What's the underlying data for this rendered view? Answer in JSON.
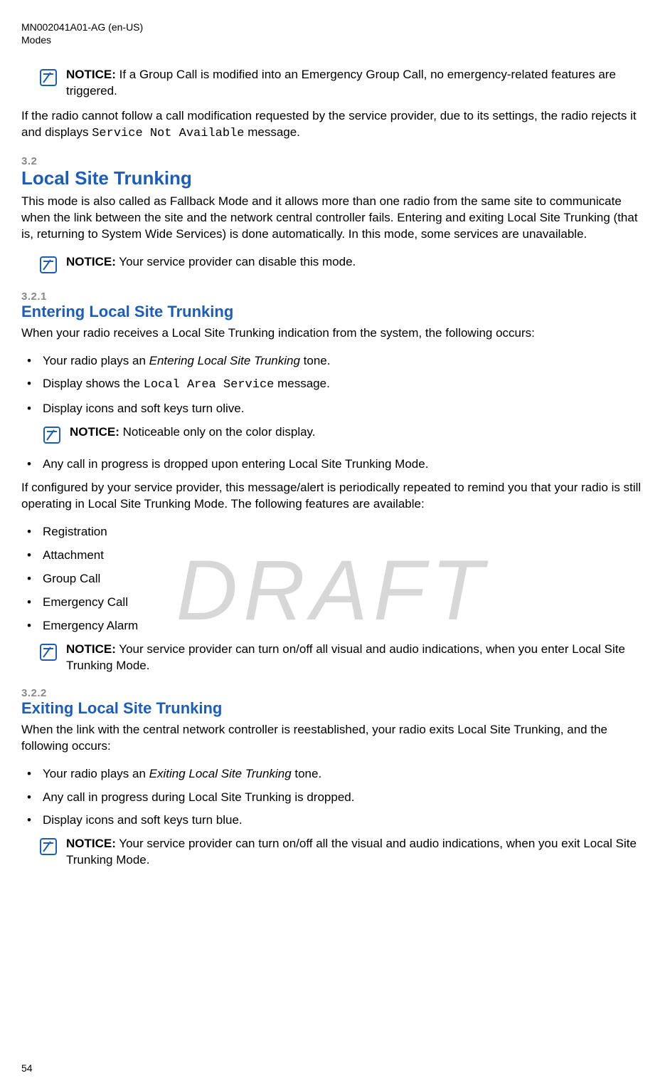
{
  "header": {
    "doc_code": "MN002041A01-AG (en-US)",
    "chapter": "Modes"
  },
  "watermark": "DRAFT",
  "page_number": "54",
  "notices": {
    "n1_label": "NOTICE:",
    "n1_text": " If a Group Call is modified into an Emergency Group Call, no emergency-related features are triggered.",
    "n2_label": "NOTICE:",
    "n2_text": " Your service provider can disable this mode.",
    "n3_label": "NOTICE:",
    "n3_text": " Noticeable only on the color display.",
    "n4_label": "NOTICE:",
    "n4_text": " Your service provider can turn on/off all visual and audio indications, when you enter Local Site Trunking Mode.",
    "n5_label": "NOTICE:",
    "n5_text": " Your service provider can turn on/off all the visual and audio indications, when you exit Local Site Trunking Mode."
  },
  "paragraphs": {
    "p1_pre": "If the radio cannot follow a call modification requested by the service provider, due to its settings, the radio rejects it and displays ",
    "p1_mono": "Service Not Available",
    "p1_post": " message.",
    "s32_intro": "This mode is also called as Fallback Mode and it allows more than one radio from the same site to communicate when the link between the site and the network central controller fails. Entering and exiting Local Site Trunking (that is, returning to System Wide Services) is done automatically. In this mode, some services are unavailable.",
    "s321_intro": "When your radio receives a Local Site Trunking indication from the system, the following occurs:",
    "s321_mid": "If configured by your service provider, this message/alert is periodically repeated to remind you that your radio is still operating in Local Site Trunking Mode. The following features are available:",
    "s322_intro": "When the link with the central network controller is reestablished, your radio exits Local Site Trunking, and the following occurs:"
  },
  "sections": {
    "s32_num": "3.2",
    "s32_title": "Local Site Trunking",
    "s321_num": "3.2.1",
    "s321_title": "Entering Local Site Trunking",
    "s322_num": "3.2.2",
    "s322_title": "Exiting Local Site Trunking"
  },
  "lists": {
    "s321_a": {
      "i1_pre": "Your radio plays an ",
      "i1_italic": "Entering Local Site Trunking",
      "i1_post": " tone.",
      "i2_pre": "Display shows the ",
      "i2_mono": "Local Area Service",
      "i2_post": " message.",
      "i3": "Display icons and soft keys turn olive.",
      "i4": "Any call in progress is dropped upon entering Local Site Trunking Mode."
    },
    "s321_b": {
      "i1": "Registration",
      "i2": "Attachment",
      "i3": "Group Call",
      "i4": "Emergency Call",
      "i5": "Emergency Alarm"
    },
    "s322": {
      "i1_pre": "Your radio plays an ",
      "i1_italic": "Exiting Local Site Trunking",
      "i1_post": " tone.",
      "i2": "Any call in progress during Local Site Trunking is dropped.",
      "i3": "Display icons and soft keys turn blue."
    }
  }
}
